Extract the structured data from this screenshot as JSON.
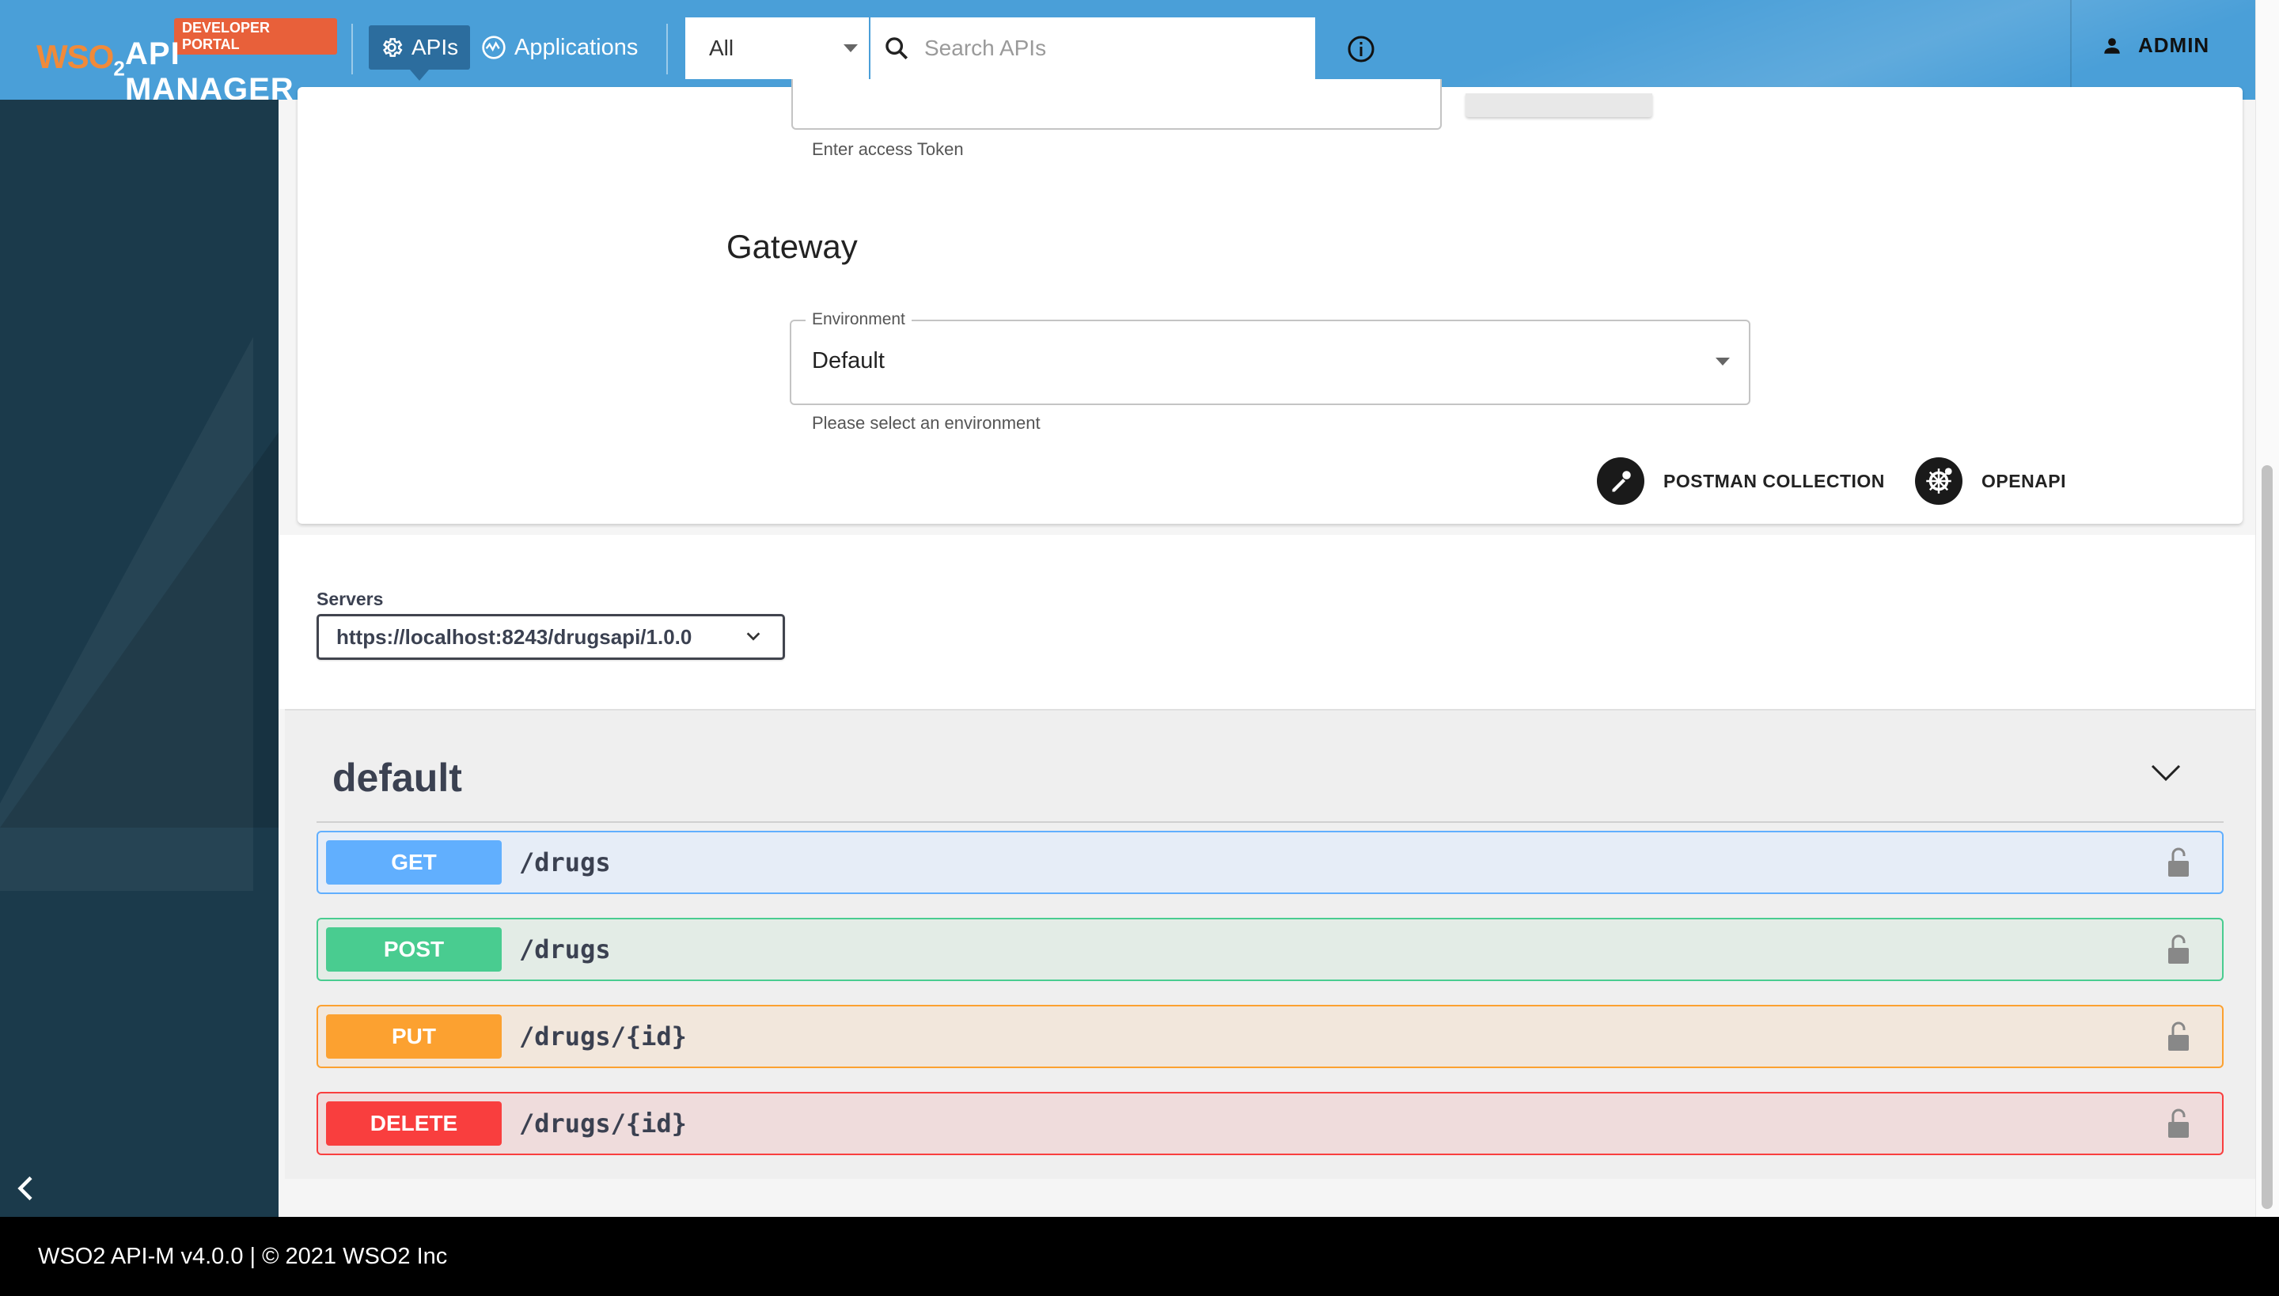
{
  "header": {
    "logo_wso2": "WSO",
    "logo_sub": "2",
    "app_name": "API MANAGER",
    "badge": "DEVELOPER PORTAL",
    "nav": [
      {
        "label": "APIs",
        "active": true
      },
      {
        "label": "Applications",
        "active": false
      }
    ],
    "scope_value": "All",
    "search_placeholder": "Search APIs",
    "user": "ADMIN",
    "colors": {
      "bar": "#4a9fd8",
      "active_nav": "#2c6d9e",
      "badge": "#e8603a"
    }
  },
  "try_out": {
    "token_helper": "Enter access Token",
    "gateway_title": "Gateway",
    "environment_label": "Environment",
    "environment_value": "Default",
    "environment_helper": "Please select an environment",
    "downloads": [
      {
        "label": "POSTMAN COLLECTION",
        "icon": "postman-icon"
      },
      {
        "label": "OPENAPI",
        "icon": "openapi-icon"
      }
    ]
  },
  "servers": {
    "label": "Servers",
    "selected": "https://localhost:8243/drugsapi/1.0.0"
  },
  "operations": {
    "tag": "default",
    "items": [
      {
        "method": "GET",
        "path": "/drugs",
        "color": "#61affe"
      },
      {
        "method": "POST",
        "path": "/drugs",
        "color": "#49cc90"
      },
      {
        "method": "PUT",
        "path": "/drugs/{id}",
        "color": "#fca130"
      },
      {
        "method": "DELETE",
        "path": "/drugs/{id}",
        "color": "#f93e3e"
      }
    ]
  },
  "footer": {
    "text": "WSO2 API-M v4.0.0 | © 2021 WSO2 Inc"
  }
}
